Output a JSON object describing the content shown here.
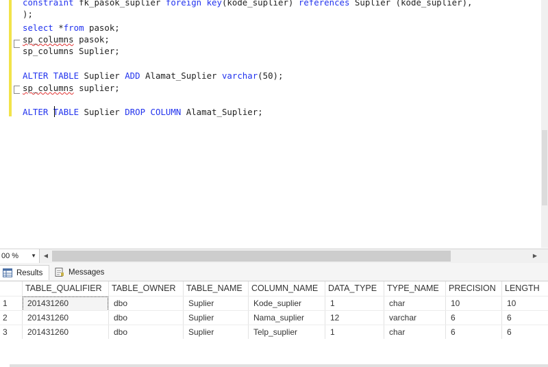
{
  "editor": {
    "lines": [
      [
        {
          "t": "constraint",
          "c": "kw"
        },
        {
          "t": " fk_pasok_suplier "
        },
        {
          "t": "foreign key",
          "c": "kw"
        },
        {
          "t": "(kode_suplier) "
        },
        {
          "t": "references",
          "c": "kw"
        },
        {
          "t": " Suplier (kode_suplier),"
        }
      ],
      [
        {
          "t": ");"
        }
      ],
      [
        {
          "t": "select",
          "c": "kw"
        },
        {
          "t": " *"
        },
        {
          "t": "from",
          "c": "kw"
        },
        {
          "t": " pasok;"
        }
      ],
      [
        {
          "t": "sp_columns",
          "c": "sq"
        },
        {
          "t": " pasok;"
        }
      ],
      [
        {
          "t": "sp_columns Suplier;"
        }
      ],
      [],
      [
        {
          "t": "ALTER TABLE",
          "c": "kw"
        },
        {
          "t": " Suplier "
        },
        {
          "t": "ADD",
          "c": "kw"
        },
        {
          "t": " Alamat_Suplier "
        },
        {
          "t": "varchar",
          "c": "kw"
        },
        {
          "t": "(50);"
        }
      ],
      [
        {
          "t": "sp_columns",
          "c": "sq"
        },
        {
          "t": " suplier;"
        }
      ],
      [],
      [
        {
          "t": "ALTER",
          "c": "kw"
        },
        {
          "t": " "
        },
        {
          "t": "TABLE",
          "c": "kw"
        },
        {
          "t": " Suplier "
        },
        {
          "t": "DROP COLUMN",
          "c": "kw"
        },
        {
          "t": " Alamat_Suplier;"
        }
      ]
    ]
  },
  "zoom": {
    "value": "00 %"
  },
  "tabs": {
    "results": "Results",
    "messages": "Messages"
  },
  "grid": {
    "columns": [
      "TABLE_QUALIFIER",
      "TABLE_OWNER",
      "TABLE_NAME",
      "COLUMN_NAME",
      "DATA_TYPE",
      "TYPE_NAME",
      "PRECISION",
      "LENGTH"
    ],
    "rows": [
      {
        "num": "1",
        "cells": [
          "201431260",
          "dbo",
          "Suplier",
          "Kode_suplier",
          "1",
          "char",
          "10",
          "10"
        ]
      },
      {
        "num": "2",
        "cells": [
          "201431260",
          "dbo",
          "Suplier",
          "Nama_suplier",
          "12",
          "varchar",
          "6",
          "6"
        ]
      },
      {
        "num": "3",
        "cells": [
          "201431260",
          "dbo",
          "Suplier",
          "Telp_suplier",
          "1",
          "char",
          "6",
          "6"
        ]
      }
    ]
  },
  "icons": {
    "results": "grid-icon",
    "messages": "messages-icon"
  },
  "colors": {
    "keyword": "#2233ee",
    "squiggle": "#e23030",
    "marker": "#f2e34a"
  }
}
